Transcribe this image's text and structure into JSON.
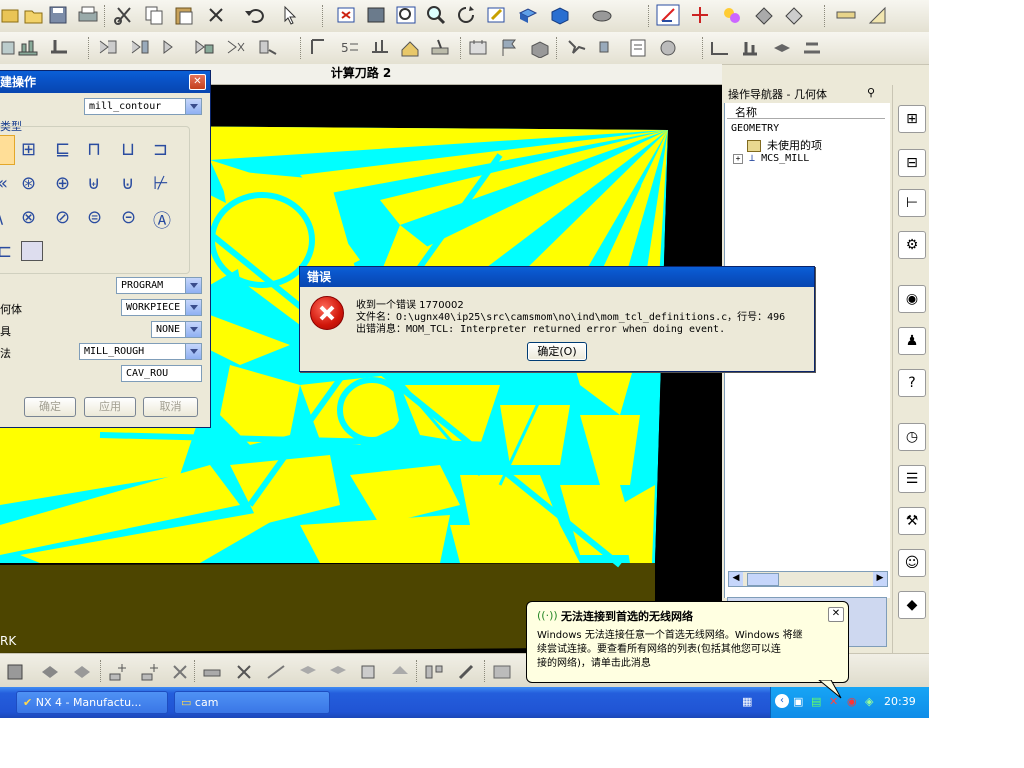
{
  "app": {
    "viewport_title": "计算刀路 2",
    "viewport_label": "RK"
  },
  "create_dialog": {
    "title": "建操作",
    "subtype_value": "mill_contour",
    "type_label": "类型",
    "program_value": "PROGRAM",
    "geometry_label": "何体",
    "geometry_value": "WORKPIECE",
    "tool_label": "具",
    "tool_value": "NONE",
    "method_label": "法",
    "method_value": "MILL_ROUGH",
    "name_value": "CAV_ROU",
    "ok_label": "确定",
    "apply_label": "应用",
    "cancel_label": "取消"
  },
  "navigator": {
    "title": "操作导航器 - 几何体",
    "column_header": "名称",
    "items": [
      "GEOMETRY",
      "未使用的项",
      "MCS_MILL"
    ]
  },
  "error_dialog": {
    "title": "错误",
    "line1": "收到一个错误 1770002",
    "line2": "文件名：O:\\ugnx40\\ip25\\src\\camsmom\\no\\ind\\mom_tcl_definitions.c，行号：496",
    "line3": "出错消息：MOM_TCL: Interpreter returned error when doing event.",
    "ok_label": "确定(O)"
  },
  "balloon": {
    "title": "无法连接到首选的无线网络",
    "body": [
      "Windows 无法连接任意一个首选无线网络。Windows 将继",
      "续尝试连接。要查看所有网络的列表(包括其他您可以连",
      "接的网络)，请单击此消息"
    ]
  },
  "taskbar": {
    "tasks": [
      "NX 4 - Manufactu...",
      "cam"
    ],
    "clock": "20:39"
  },
  "colors": {
    "cyan": "#00ffff",
    "yellow": "#ffff00",
    "olive": "#4d4500",
    "xp_blue": "#0a5fd6"
  }
}
